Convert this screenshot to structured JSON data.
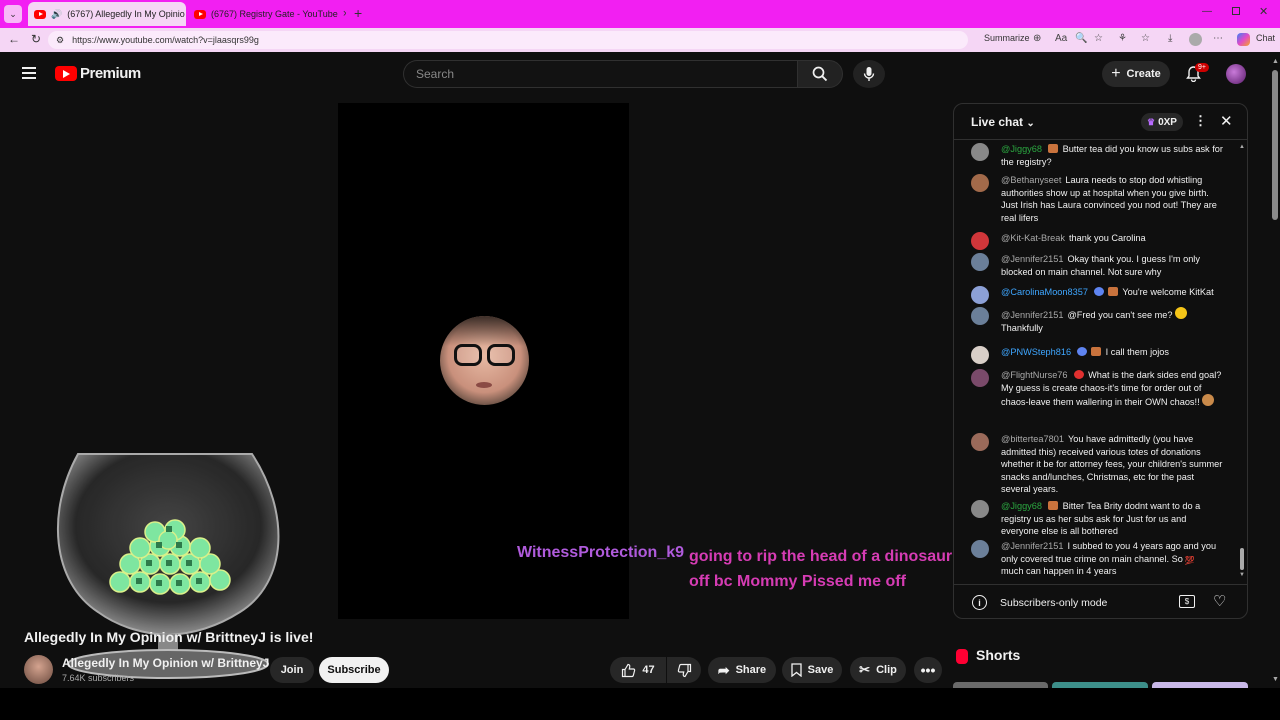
{
  "browser": {
    "tabs": [
      {
        "label": "(6767) Allegedly In My Opinio",
        "active": true
      },
      {
        "label": "(6767) Registry Gate - YouTube",
        "active": false
      }
    ],
    "url": "https://www.youtube.com/watch?v=jlaasqrs99g",
    "summarize_label": "Summarize",
    "chat_label": "Chat"
  },
  "header": {
    "logo_text": "Premium",
    "search_placeholder": "Search",
    "create_label": "Create",
    "notification_count": "9+"
  },
  "player": {
    "overlay_username": "WitnessProtection_k9",
    "overlay_message": "going to rip the head of a dinosaur off bc Mommy Pissed me off"
  },
  "video": {
    "title": "Allegedly In My Opinion w/ BrittneyJ is live!",
    "channel_name": "Allegedly In My Opinion w/ BrittneyJ",
    "subscribers": "7.64K subscribers",
    "join_label": "Join",
    "subscribe_label": "Subscribe",
    "like_count": "47",
    "share_label": "Share",
    "save_label": "Save",
    "clip_label": "Clip"
  },
  "live_chat": {
    "title": "Live chat",
    "xp_label": "0XP",
    "footer_mode": "Subscribers-only mode",
    "messages": [
      {
        "author": "@Jiggy68",
        "text": "Butter tea did you know us subs ask for the registry?"
      },
      {
        "author": "@Bethanyseet",
        "text": "Laura needs to stop dod whistling authorities show up at hospital when you give birth. Just Irish has Laura convinced you nod out! They are real lifers"
      },
      {
        "author": "@Kit-Kat-Break",
        "text": "thank you Carolina"
      },
      {
        "author": "@Jennifer2151",
        "text": "Okay thank you. I guess I'm only blocked on main channel. Not sure why"
      },
      {
        "author": "@CarolinaMoon8357",
        "text": "You're welcome KitKat"
      },
      {
        "author": "@Jennifer2151",
        "text": "@Fred you can't see me?",
        "text2": "Thankfully"
      },
      {
        "author": "@PNWSteph816",
        "text": "I call them jojos"
      },
      {
        "author": "@FlightNurse76",
        "text": "What is the dark sides end goal? My guess is create chaos-it's time for order out of chaos-leave them wallering in their OWN chaos!!"
      },
      {
        "author": "@bittertea7801",
        "text": "You have admittedly (you have admitted this) received various totes of donations whether it be for attorney fees, your children's summer snacks and/lunches, Christmas, etc for the past several years."
      },
      {
        "author": "@Jiggy68",
        "text": "Bitter Tea Brity dodnt want to do a registry us as her subs ask for Just for us and everyone else is all bothered"
      },
      {
        "author": "@Jennifer2151",
        "text": "I subbed to you 4 years ago and you only covered true crime on main channel. So",
        "text2": "much can happen in 4 years"
      }
    ]
  },
  "shorts": {
    "title": "Shorts"
  },
  "colors": {
    "browser_accent": "#f21ff2",
    "youtube_red": "#ff0000",
    "member_green": "#2ba640",
    "overlay_name": "#b05bdc",
    "overlay_message": "#d63cb4"
  }
}
